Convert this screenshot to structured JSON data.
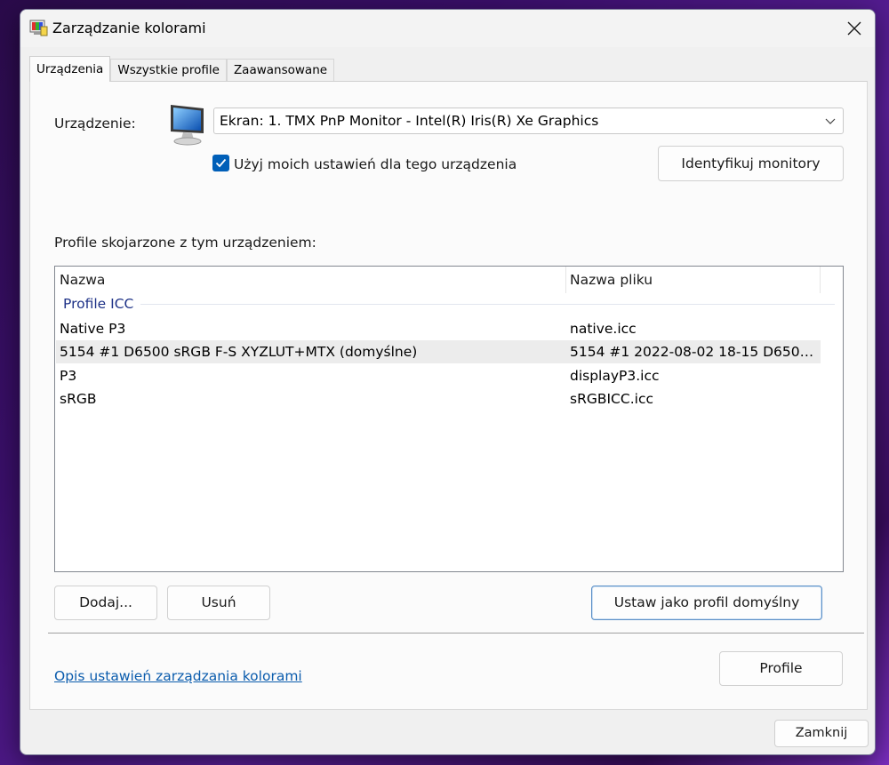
{
  "window": {
    "title": "Zarządzanie kolorami",
    "close_glyph": "✕"
  },
  "tabs": [
    {
      "label": "Urządzenia",
      "active": true
    },
    {
      "label": "Wszystkie profile",
      "active": false
    },
    {
      "label": "Zaawansowane",
      "active": false
    }
  ],
  "device": {
    "label": "Urządzenie:",
    "selected": "Ekran: 1. TMX PnP Monitor - Intel(R) Iris(R) Xe Graphics",
    "icon": "monitor-icon"
  },
  "use_settings": {
    "label": "Użyj moich ustawień dla tego urządzenia",
    "checked": true
  },
  "identify_button": "Identyfikuj monitory",
  "profiles_label": "Profile skojarzone z tym urządzeniem:",
  "list": {
    "columns": [
      "Nazwa",
      "Nazwa pliku"
    ],
    "group": "Profile ICC",
    "rows": [
      {
        "name": "Native P3",
        "file": "native.icc",
        "selected": false
      },
      {
        "name": "5154 #1 D6500 sRGB F-S XYZLUT+MTX (domyślne)",
        "file": "5154 #1 2022-08-02 18-15 D6500 ...",
        "selected": true
      },
      {
        "name": "P3",
        "file": "displayP3.icc",
        "selected": false
      },
      {
        "name": "sRGB",
        "file": "sRGBICC.icc",
        "selected": false
      }
    ]
  },
  "buttons": {
    "add": "Dodaj...",
    "remove": "Usuń",
    "set_default": "Ustaw jako profil domyślny",
    "profiles": "Profile",
    "close": "Zamknij"
  },
  "help_link": "Opis ustawień zarządzania kolorami",
  "colors": {
    "accent": "#005fb8",
    "link": "#0b5cad",
    "group_header": "#1e3287"
  }
}
